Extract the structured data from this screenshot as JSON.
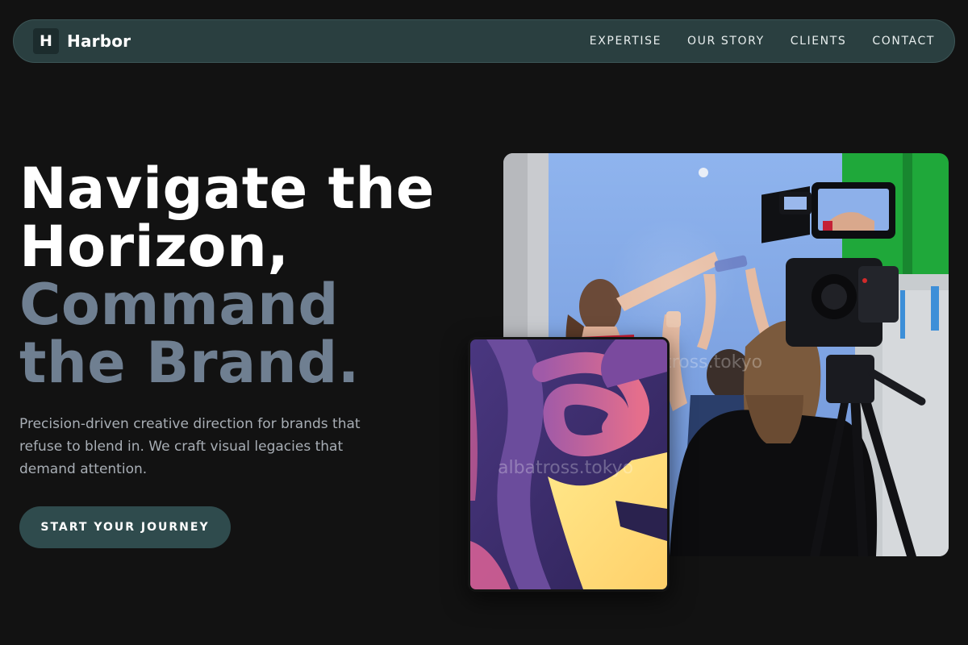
{
  "nav": {
    "brand_mark": "H",
    "brand_name": "Harbor",
    "links": [
      "EXPERTISE",
      "OUR STORY",
      "CLIENTS",
      "CONTACT"
    ]
  },
  "hero": {
    "title_lines": [
      "Navigate the",
      "Horizon,",
      "Command",
      "the Brand."
    ],
    "subtitle": "Precision-driven creative direction for brands that refuse to blend in. We craft visual legacies that demand attention.",
    "cta_label": "START YOUR JOURNEY"
  },
  "media": {
    "watermark_main": "tross.tokyo",
    "watermark_secondary": "albatross.tokyo"
  },
  "colors": {
    "background": "#121212",
    "nav_bg": "#2a3f40",
    "accent": "#2f4b4d",
    "title_muted": "#6f7f91"
  }
}
